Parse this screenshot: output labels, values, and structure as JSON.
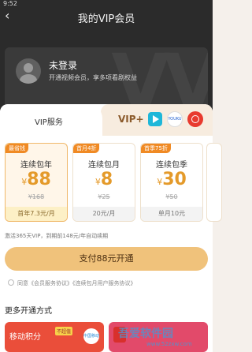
{
  "status": {
    "time": "9:52"
  },
  "nav": {
    "back": "‹",
    "title": "我的VIP会员"
  },
  "user": {
    "name": "未登录",
    "desc": "开通视频会员，享多项看剧权益"
  },
  "tabs": {
    "vip": "VIP服务",
    "vipplus": "VIP+",
    "brand2": "YOUKU"
  },
  "plans": [
    {
      "tag": "最省钱",
      "name": "连续包年",
      "cur": "¥",
      "price": "88",
      "orig": "¥168",
      "note": "首年7.3元/月"
    },
    {
      "tag": "首月4折",
      "name": "连续包月",
      "cur": "¥",
      "price": "8",
      "orig": "¥25",
      "note": "20元/月"
    },
    {
      "tag": "首季75折",
      "name": "连续包季",
      "cur": "¥",
      "price": "30",
      "orig": "¥50",
      "note": "单月10元"
    }
  ],
  "renew_text": "激活365天VIP，到期前148元/年自动续期",
  "pay_button": "支付88元开通",
  "agreement": "同意《会员服务协议》《连续包月用户服务协议》",
  "more_title": "更多开通方式",
  "pay_methods": [
    {
      "title": "移动积分",
      "badge": "不超值",
      "logo": "中国移动"
    }
  ],
  "watermark": {
    "text": "吾爱软件园",
    "url": "www.52zxw.com"
  }
}
